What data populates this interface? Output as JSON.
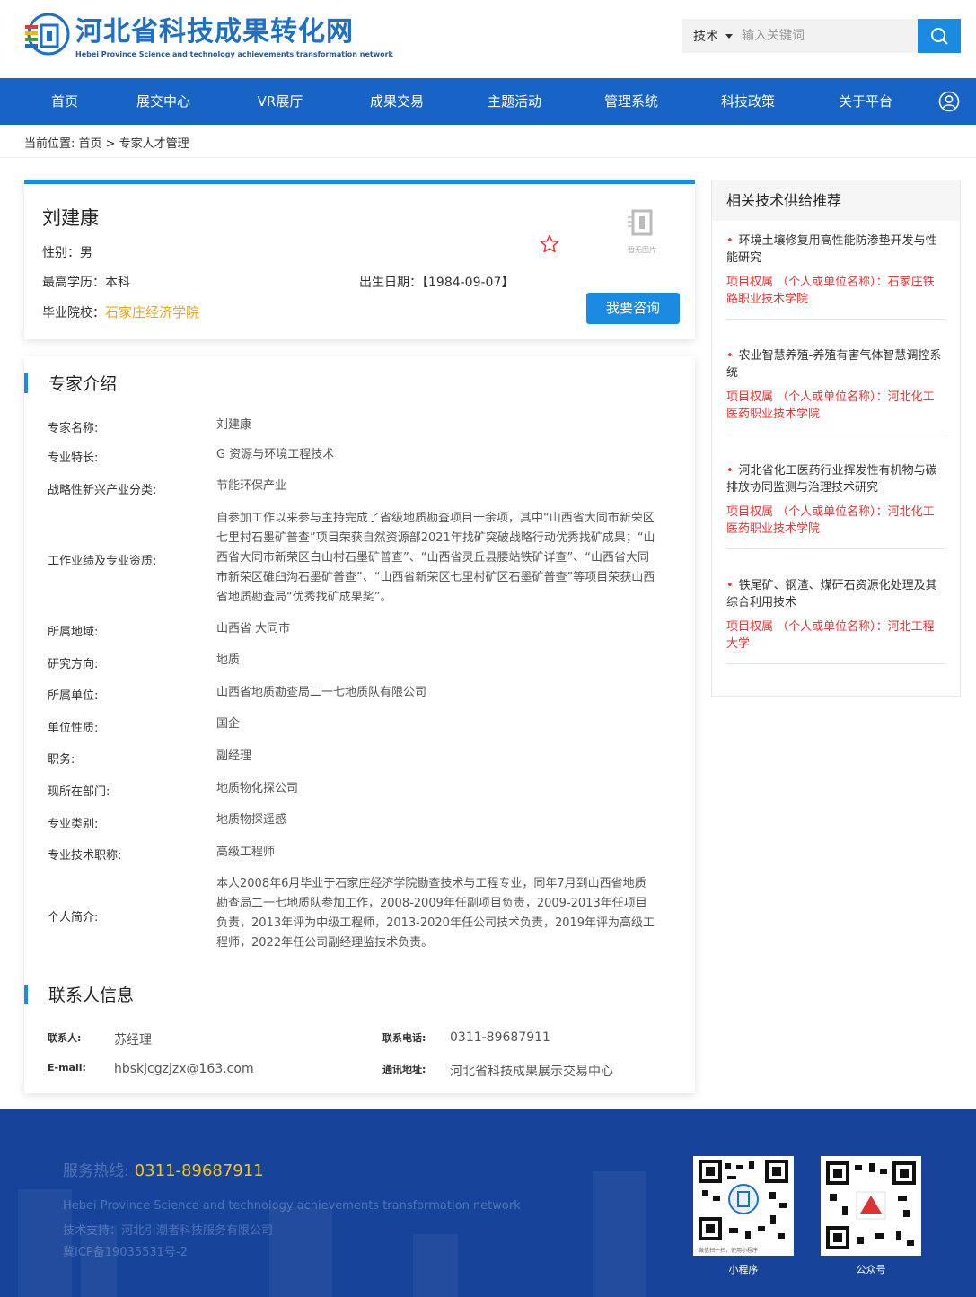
{
  "header": {
    "logo_cn": "河北省科技成果转化网",
    "logo_en": "Hebei Province Science and technology achievements transformation network",
    "search_type": "技术",
    "search_placeholder": "输入关键词"
  },
  "nav": [
    "首页",
    "展交中心",
    "VR展厅",
    "成果交易",
    "主题活动",
    "管理系统",
    "科技政策",
    "关于平台"
  ],
  "breadcrumb": "当前位置:  首页 > 专家人才管理",
  "profile": {
    "name": "刘建康",
    "gender": "性别：男",
    "education": "最高学历：本科",
    "birth": "出生日期：【1984-09-07】",
    "school_label": "毕业院校：",
    "school": "石家庄经济学院",
    "noimg": "暂无图片",
    "consult": "我要咨询"
  },
  "intro": {
    "title": "专家介绍",
    "rows": [
      {
        "label": "专家名称:",
        "value": "刘建康"
      },
      {
        "label": "专业特长:",
        "value": "G 资源与环境工程技术"
      },
      {
        "label": "战略性新兴产业分类:",
        "value": "节能环保产业"
      },
      {
        "label": "工作业绩及专业资质:",
        "value": "自参加工作以来参与主持完成了省级地质勘查项目十余项，其中“山西省大同市新荣区七里村石墨矿普查”项目荣获自然资源部2021年找矿突破战略行动优秀找矿成果；“山西省大同市新荣区白山村石墨矿普查”、“山西省灵丘县腰站铁矿详查”、“山西省大同市新荣区碓臼沟石墨矿普查”、“山西省新荣区七里村矿区石墨矿普查”等项目荣获山西省地质勘查局“优秀找矿成果奖”。"
      },
      {
        "label": "所属地域:",
        "value": "山西省 大同市"
      },
      {
        "label": "研究方向:",
        "value": "地质"
      },
      {
        "label": "所属单位:",
        "value": "山西省地质勘查局二一七地质队有限公司"
      },
      {
        "label": "单位性质:",
        "value": "国企"
      },
      {
        "label": "职务:",
        "value": "副经理"
      },
      {
        "label": "现所在部门:",
        "value": "地质物化探公司"
      },
      {
        "label": "专业类别:",
        "value": "地质物探遥感"
      },
      {
        "label": "专业技术职称:",
        "value": "高级工程师"
      },
      {
        "label": "个人简介:",
        "value": "本人2008年6月毕业于石家庄经济学院勘查技术与工程专业，同年7月到山西省地质勘查局二一七地质队参加工作，2008-2009年任副项目负责，2009-2013年任项目负责，2013年评为中级工程师，2013-2020年任公司技术负责，2019年评为高级工程师，2022年任公司副经理监技术负责。"
      }
    ]
  },
  "contact": {
    "title": "联系人信息",
    "person_label": "联系人:",
    "person": "苏经理",
    "phone_label": "联系电话:",
    "phone": "0311-89687911",
    "email_label": "E-mail:",
    "email": "hbskjcgzjzx@163.com",
    "address_label": "通讯地址:",
    "address": "河北省科技成果展示交易中心"
  },
  "sidebar": {
    "title": "相关技术供给推荐",
    "items": [
      {
        "title": "环境土壤修复用高性能防渗垫开发与性能研究",
        "owner": "项目权属 （个人或单位名称）：石家庄铁路职业技术学院"
      },
      {
        "title": "农业智慧养殖-养殖有害气体智慧调控系统",
        "owner": "项目权属 （个人或单位名称）：河北化工医药职业技术学院"
      },
      {
        "title": "河北省化工医药行业挥发性有机物与碳排放协同监测与治理技术研究",
        "owner": "项目权属 （个人或单位名称）：河北化工医药职业技术学院"
      },
      {
        "title": "铁尾矿、钢渣、煤矸石资源化处理及其综合利用技术",
        "owner": "项目权属 （个人或单位名称）：河北工程大学"
      }
    ]
  },
  "footer": {
    "hotline_label": "服务热线:",
    "hotline": "0311-89687911",
    "en": "Hebei Province Science and technology achievements transformation network",
    "support": "技术支持：河北引潮者科技服务有限公司",
    "icp": "冀ICP备19035531号-2",
    "mini_note": "微信扫一扫，使用小程序",
    "qr1": "小程序",
    "qr2": "公众号"
  }
}
